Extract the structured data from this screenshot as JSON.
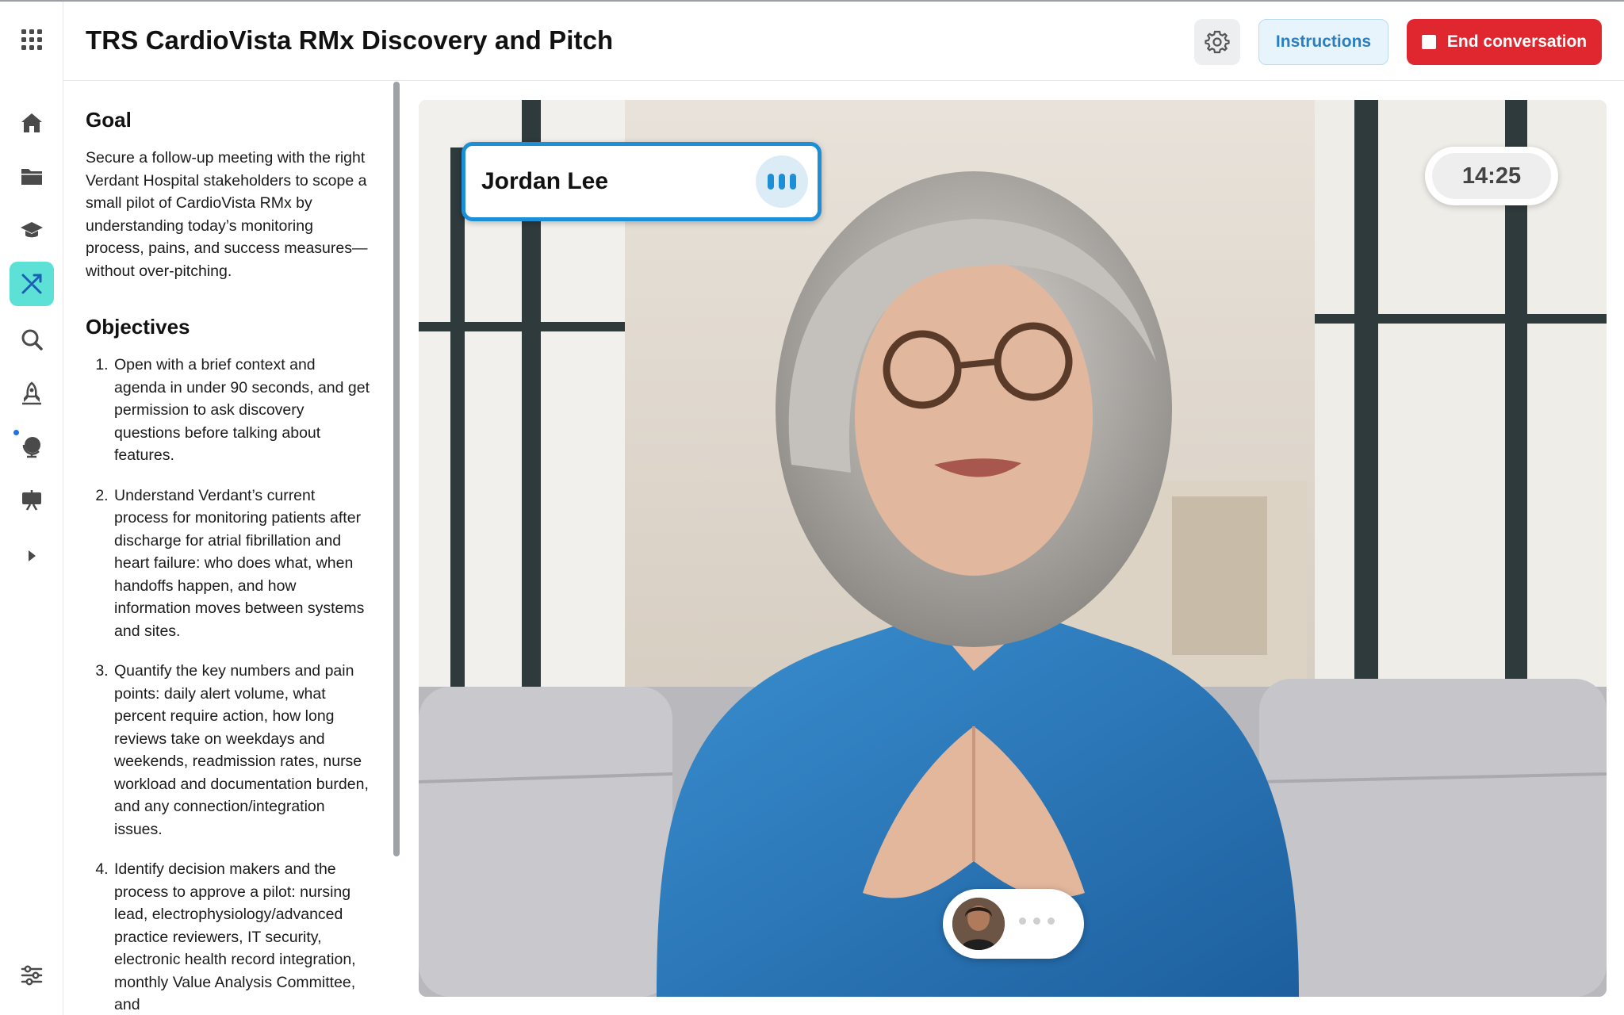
{
  "header": {
    "title": "TRS CardioVista RMx Discovery and Pitch",
    "instructions_label": "Instructions",
    "end_label": "End conversation"
  },
  "rail": {
    "icons": [
      "apps-grid-icon",
      "home-icon",
      "folder-icon",
      "graduation-cap-icon",
      "practice-arrows-icon",
      "search-icon",
      "rocket-icon",
      "globe-icon",
      "presentation-board-icon",
      "expand-arrow-icon",
      "sliders-icon"
    ],
    "active": "practice-arrows-icon"
  },
  "instructions": {
    "goal_heading": "Goal",
    "goal_text": "Secure a follow-up meeting with the right Verdant Hospital stakeholders to scope a small pilot of CardioVista RMx by understanding today’s monitoring process, pains, and success measures—without over-pitching.",
    "objectives_heading": "Objectives",
    "objectives": [
      "Open with a brief context and agenda in under 90 seconds, and get permission to ask discovery questions before talking about features.",
      "Understand Verdant’s current process for monitoring patients after discharge for atrial fibrillation and heart failure: who does what, when handoffs happen, and how information moves between systems and sites.",
      "Quantify the key numbers and pain points: daily alert volume, what percent require action, how long reviews take on weekdays and weekends, readmission rates, nurse workload and documentation burden, and any connection/integration issues.",
      "Identify decision makers and the process to approve a pilot: nursing lead, electrophysiology/advanced practice reviewers, IT security, electronic health record integration, monthly Value Analysis Committee, and"
    ]
  },
  "call": {
    "participant_name": "Jordan Lee",
    "timer": "14:25"
  },
  "colors": {
    "accent_blue": "#1c8fd6",
    "end_red": "#e0262f",
    "active_rail": "#5de0d6",
    "instructions_bg": "#e8f4fb"
  }
}
